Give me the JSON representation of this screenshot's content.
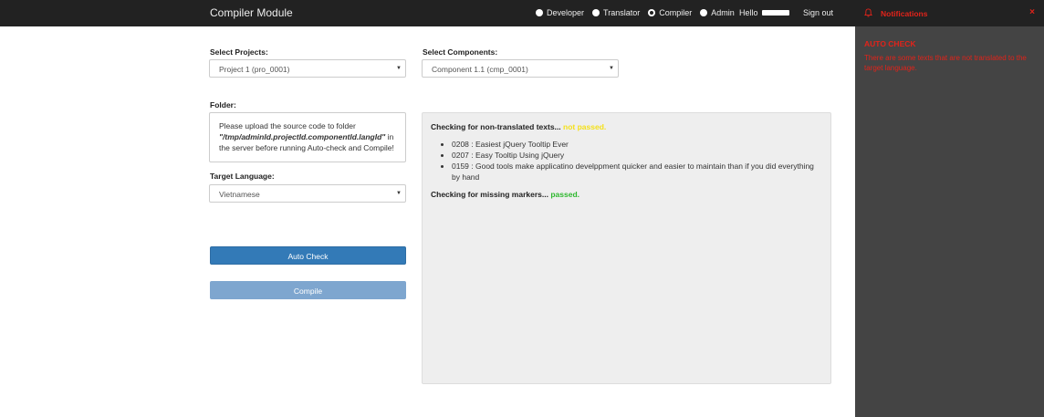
{
  "navbar": {
    "brand": "Compiler Module",
    "roles": [
      {
        "label": "Developer",
        "checked": false
      },
      {
        "label": "Translator",
        "checked": false
      },
      {
        "label": "Compiler",
        "checked": true
      },
      {
        "label": "Admin",
        "checked": false
      }
    ],
    "hello": "Hello",
    "signout": "Sign out"
  },
  "form": {
    "projects_label": "Select Projects:",
    "projects_value": "Project 1 (pro_0001)",
    "components_label": "Select Components:",
    "components_value": "Component 1.1 (cmp_0001)",
    "folder_label": "Folder:",
    "folder_text_pre": "Please upload the source code to folder",
    "folder_path": "\"/tmp/adminId.projectId.componentId.langId\"",
    "folder_text_in": " in",
    "folder_text_post": "the server before running Auto-check and Compile!",
    "language_label": "Target Language:",
    "language_value": "Vietnamese",
    "auto_check_label": "Auto Check",
    "compile_label": "Compile"
  },
  "results": {
    "check1_label": "Checking for non-translated texts...",
    "check1_status": "not passed.",
    "items": [
      "0208 : Easiest jQuery Tooltip Ever",
      "0207 : Easy Tooltip Using jQuery",
      "0159 : Good tools make applicatino develppment quicker and easier to maintain than if you did everything by hand"
    ],
    "check2_label": "Checking for missing markers...",
    "check2_status": "passed."
  },
  "notifications": {
    "title": "Notifications",
    "close": "×",
    "heading": "AUTO CHECK",
    "message": "There are some texts that are not translated to the target language."
  },
  "colors": {
    "navbar": "#222222",
    "primary": "#337ab7",
    "alert": "#e2231a",
    "pass": "#2fb82f",
    "fail": "#f5e11a"
  }
}
